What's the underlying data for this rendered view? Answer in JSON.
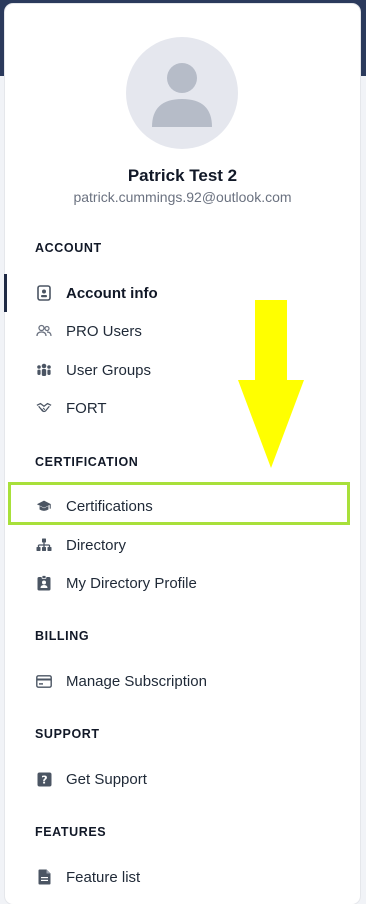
{
  "user": {
    "name": "Patrick Test 2",
    "email": "patrick.cummings.92@outlook.com"
  },
  "sections": {
    "account": {
      "title": "ACCOUNT",
      "items": [
        {
          "label": "Account info",
          "icon": "id-badge-icon",
          "active": true
        },
        {
          "label": "PRO Users",
          "icon": "users-icon"
        },
        {
          "label": "User Groups",
          "icon": "user-group-icon"
        },
        {
          "label": "FORT",
          "icon": "handshake-icon"
        }
      ]
    },
    "certification": {
      "title": "CERTIFICATION",
      "items": [
        {
          "label": "Certifications",
          "icon": "graduation-cap-icon",
          "highlighted": true
        },
        {
          "label": "Directory",
          "icon": "sitemap-icon"
        },
        {
          "label": "My Directory Profile",
          "icon": "profile-badge-icon"
        }
      ]
    },
    "billing": {
      "title": "BILLING",
      "items": [
        {
          "label": "Manage Subscription",
          "icon": "credit-card-icon"
        }
      ]
    },
    "support": {
      "title": "SUPPORT",
      "items": [
        {
          "label": "Get Support",
          "icon": "question-square-icon"
        }
      ]
    },
    "features": {
      "title": "FEATURES",
      "items": [
        {
          "label": "Feature list",
          "icon": "document-icon"
        }
      ]
    }
  },
  "colors": {
    "header_band": "#2b3a5c",
    "highlight_border": "#a8e03a",
    "arrow": "#ffff00",
    "icon": "#4b5563"
  }
}
